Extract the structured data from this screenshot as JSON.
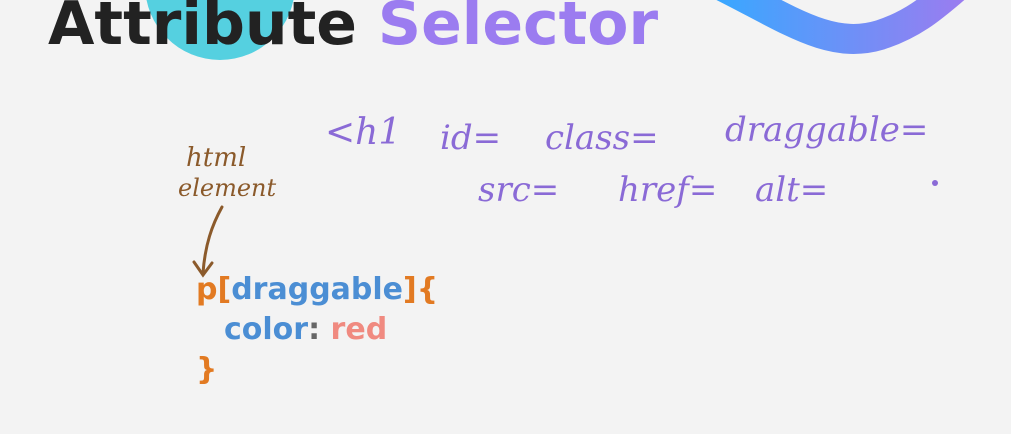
{
  "title": {
    "word1": "Attribute",
    "word2": "Selector"
  },
  "handwriting": {
    "line1": [
      "<h1",
      "id=",
      "class=",
      "draggable="
    ],
    "line2": [
      "src=",
      "href=",
      "alt="
    ],
    "annotation": [
      "html",
      "element"
    ]
  },
  "code": {
    "selector": "p",
    "open_bracket": "[",
    "attribute": "draggable",
    "close_bracket": "]",
    "open_brace": "{",
    "property": "color",
    "colon": ":",
    "value": "red",
    "close_brace": "}"
  },
  "colors": {
    "title_dark": "#222222",
    "title_purple": "#9b7cf0",
    "accent_teal": "#55d0e0",
    "ink_purple": "#8a6ad6",
    "ink_brown": "#8b5a2b",
    "code_orange": "#e27a22",
    "code_blue": "#4b8ed4",
    "code_red": "#f08a80"
  }
}
